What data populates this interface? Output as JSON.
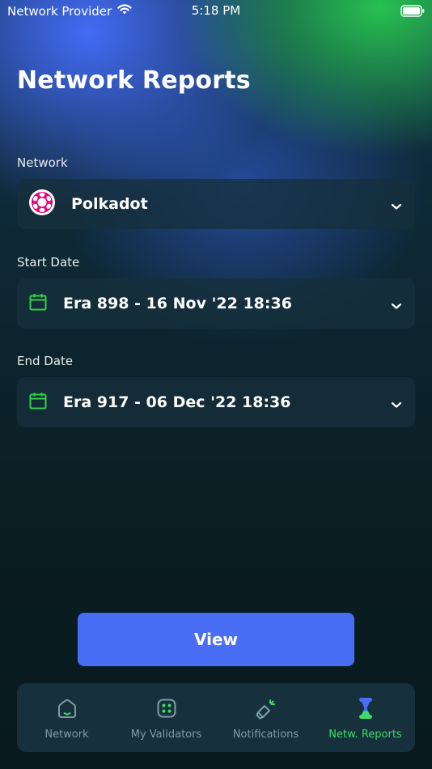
{
  "status_bar": {
    "carrier": "Network Provider",
    "time": "5:18 PM"
  },
  "page": {
    "title": "Network Reports"
  },
  "form": {
    "network": {
      "label": "Network",
      "value": "Polkadot",
      "icon": "polkadot-logo-icon"
    },
    "start_date": {
      "label": "Start Date",
      "value": "Era 898 - 16 Nov '22 18:36",
      "icon": "calendar-icon"
    },
    "end_date": {
      "label": "End Date",
      "value": "Era 917 - 06 Dec '22 18:36",
      "icon": "calendar-icon"
    }
  },
  "actions": {
    "view_label": "View"
  },
  "tab_bar": {
    "items": [
      {
        "label": "Network",
        "icon": "home-icon",
        "active": false
      },
      {
        "label": "My Validators",
        "icon": "validators-icon",
        "active": false
      },
      {
        "label": "Notifications",
        "icon": "megaphone-icon",
        "active": false
      },
      {
        "label": "Netw. Reports",
        "icon": "hourglass-icon",
        "active": true
      }
    ]
  },
  "colors": {
    "accent_blue": "#4a6df5",
    "active_green": "#3ddc6a",
    "polkadot_pink": "#e6007a",
    "calendar_green": "#35d04a",
    "card_bg": "#16313b"
  }
}
